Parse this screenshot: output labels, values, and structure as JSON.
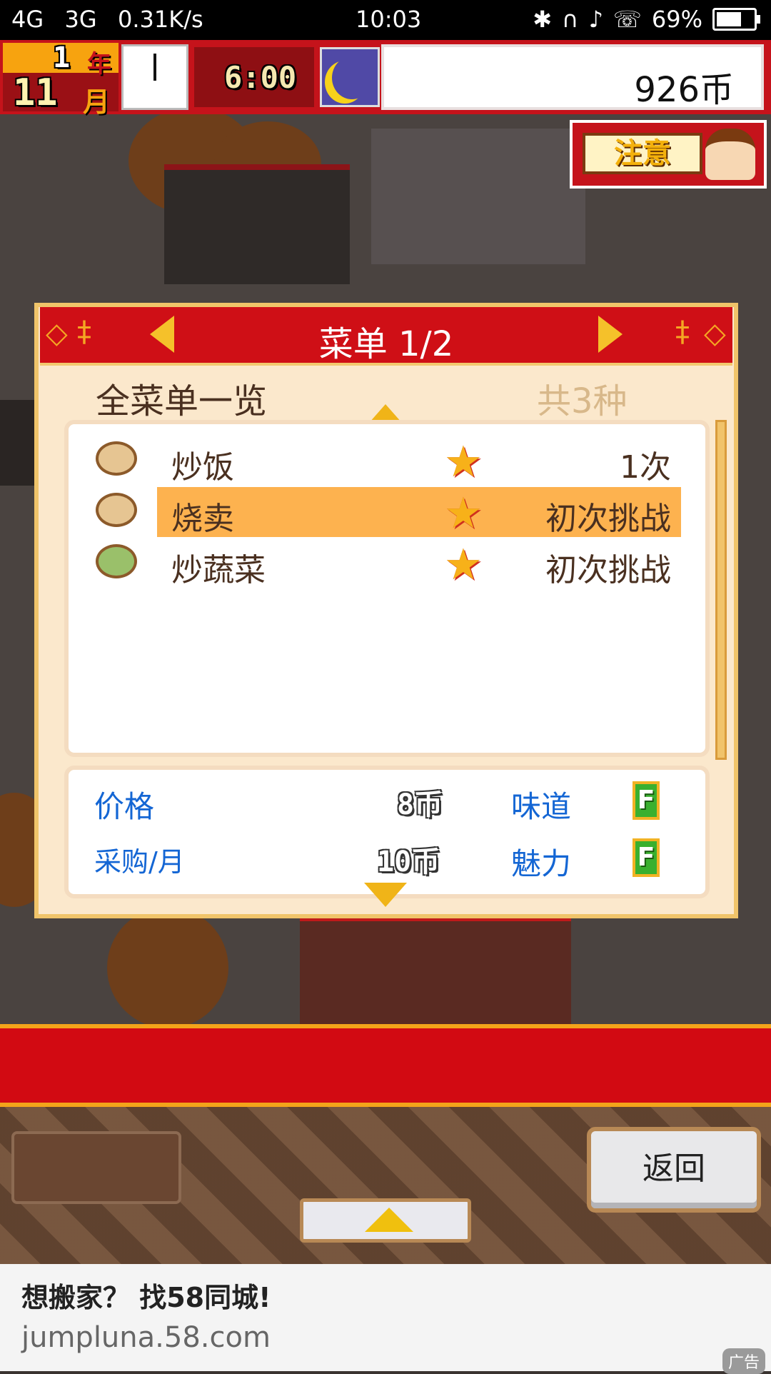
{
  "status_bar": {
    "network": "4G    3G    0.31K/s",
    "time": "10:03",
    "battery": "69%",
    "icons": [
      "bluetooth-icon",
      "headset-icon",
      "bell-muted-icon",
      "hd-call-icon",
      "battery-icon",
      "wifi-icon",
      "signal-icon"
    ]
  },
  "hud": {
    "year_num": "1",
    "year_char": "年",
    "month_num": "11",
    "month_char": "月",
    "game_time": "6:00",
    "money": "926币"
  },
  "alert": {
    "label": "注意"
  },
  "panel": {
    "title": "菜单 1/2",
    "subtitle": "全菜单一览",
    "count": "共3种",
    "items": [
      {
        "name": "炒饭",
        "stat": "1次",
        "selected": false
      },
      {
        "name": "烧卖",
        "stat": "初次挑战",
        "selected": true
      },
      {
        "name": "炒蔬菜",
        "stat": "初次挑战",
        "selected": false
      }
    ],
    "info": {
      "price_label": "价格",
      "price_value": "8币",
      "purchase_label": "采购/月",
      "purchase_value": "10币",
      "taste_label": "味道",
      "taste_grade": "F",
      "charm_label": "魅力",
      "charm_grade": "F"
    }
  },
  "controls": {
    "back_label": "返回"
  },
  "ad": {
    "title": "想搬家？ 找58同城!",
    "url": "jumpluna.58.com",
    "tag": "广告"
  },
  "colors": {
    "accent_red": "#cf0f16",
    "gold": "#f3a41a",
    "highlight": "#fdb24f",
    "link_blue": "#1466d4"
  }
}
